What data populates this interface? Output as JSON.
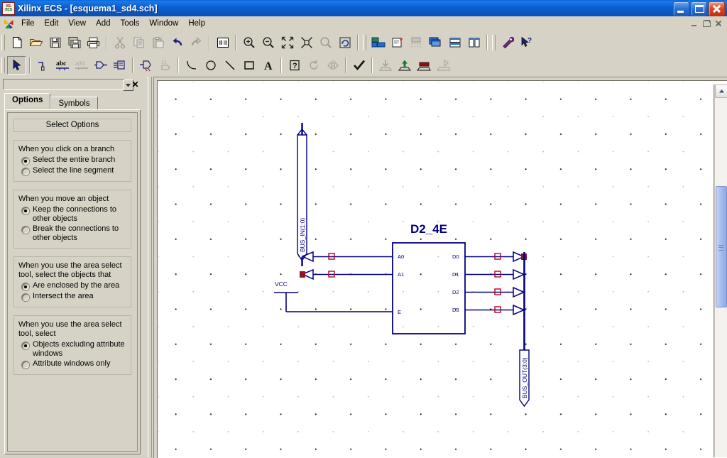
{
  "window": {
    "app_name": "Xilinx ECS",
    "document": "[esquema1_sd4.sch]",
    "title": "Xilinx ECS - [esquema1_sd4.sch]",
    "icon": "xilinx-ecs-icon",
    "controls": {
      "minimize": "minimize-icon",
      "restore": "restore-icon",
      "close": "close-icon"
    },
    "mdi_controls": {
      "minimize": "mdi-minimize-icon",
      "restore": "mdi-restore-icon",
      "close": "mdi-close-icon"
    }
  },
  "menu": {
    "items": [
      {
        "label": "File"
      },
      {
        "label": "Edit"
      },
      {
        "label": "View"
      },
      {
        "label": "Add"
      },
      {
        "label": "Tools"
      },
      {
        "label": "Window"
      },
      {
        "label": "Help"
      }
    ]
  },
  "toolbar_main": {
    "groups": [
      {
        "buttons": [
          {
            "name": "new-icon",
            "enabled": true
          },
          {
            "name": "open-icon",
            "enabled": true
          },
          {
            "name": "save-icon",
            "enabled": true
          },
          {
            "name": "save-all-icon",
            "enabled": true
          },
          {
            "name": "print-icon",
            "enabled": true
          }
        ]
      },
      {
        "buttons": [
          {
            "name": "cut-icon",
            "enabled": false
          },
          {
            "name": "copy-icon",
            "enabled": false
          },
          {
            "name": "paste-icon",
            "enabled": false
          },
          {
            "name": "undo-icon",
            "enabled": true
          },
          {
            "name": "redo-icon",
            "enabled": false
          }
        ]
      },
      {
        "buttons": [
          {
            "name": "find-icon",
            "enabled": true
          }
        ]
      },
      {
        "buttons": [
          {
            "name": "zoom-in-icon",
            "enabled": true
          },
          {
            "name": "zoom-out-icon",
            "enabled": true
          },
          {
            "name": "zoom-fit-icon",
            "enabled": true
          },
          {
            "name": "zoom-selection-icon",
            "enabled": true
          },
          {
            "name": "zoom-area-icon",
            "enabled": false
          },
          {
            "name": "refresh-icon",
            "enabled": true
          }
        ]
      },
      {
        "buttons": [
          {
            "name": "hierarchy-push-icon",
            "enabled": true
          },
          {
            "name": "new-sheet-icon",
            "enabled": true
          },
          {
            "name": "sheet-properties-icon",
            "enabled": false
          },
          {
            "name": "cascade-windows-icon",
            "enabled": true
          },
          {
            "name": "tile-horizontal-icon",
            "enabled": true
          },
          {
            "name": "tile-vertical-icon",
            "enabled": true
          }
        ]
      },
      {
        "buttons": [
          {
            "name": "options-tool-icon",
            "enabled": true
          },
          {
            "name": "context-help-icon",
            "enabled": true
          }
        ]
      }
    ]
  },
  "toolbar_draw": {
    "groups": [
      {
        "buttons": [
          {
            "name": "select-tool-icon",
            "enabled": true,
            "pressed": true
          }
        ]
      },
      {
        "buttons": [
          {
            "name": "add-wire-icon",
            "enabled": true
          },
          {
            "name": "add-net-name-icon",
            "enabled": true
          },
          {
            "name": "add-bus-name-icon",
            "enabled": false
          },
          {
            "name": "add-io-marker-icon",
            "enabled": true
          },
          {
            "name": "add-symbol-icon",
            "enabled": true
          }
        ]
      },
      {
        "buttons": [
          {
            "name": "edit-attributes-icon",
            "enabled": true
          },
          {
            "name": "add-instance-name-icon",
            "enabled": false
          }
        ]
      },
      {
        "buttons": [
          {
            "name": "draw-arc-icon",
            "enabled": true
          },
          {
            "name": "draw-circle-icon",
            "enabled": true
          },
          {
            "name": "draw-line-icon",
            "enabled": true
          },
          {
            "name": "draw-rectangle-icon",
            "enabled": true
          },
          {
            "name": "add-text-icon",
            "enabled": true
          }
        ]
      },
      {
        "buttons": [
          {
            "name": "help-question-icon",
            "enabled": true
          },
          {
            "name": "rotate-icon",
            "enabled": false
          },
          {
            "name": "mirror-icon",
            "enabled": false
          }
        ]
      },
      {
        "buttons": [
          {
            "name": "check-schematic-icon",
            "enabled": true
          }
        ]
      },
      {
        "buttons": [
          {
            "name": "push-into-symbol-icon",
            "enabled": false
          },
          {
            "name": "pop-out-symbol-icon",
            "enabled": true
          },
          {
            "name": "create-symbol-icon",
            "enabled": true
          },
          {
            "name": "export-symbol-icon",
            "enabled": false
          }
        ]
      }
    ]
  },
  "panel": {
    "close_label": "✕",
    "dropdown_icon": "chevron-down-icon",
    "tabs": [
      {
        "label": "Options",
        "active": true
      },
      {
        "label": "Symbols",
        "active": false
      }
    ],
    "group_title": "Select Options",
    "groups": [
      {
        "label": "When you click on a branch",
        "options": [
          {
            "label": "Select the entire branch",
            "selected": true
          },
          {
            "label": "Select the line segment",
            "selected": false
          }
        ]
      },
      {
        "label": "When you move an object",
        "options": [
          {
            "label": "Keep the connections to other objects",
            "selected": true
          },
          {
            "label": "Break the connections to other objects",
            "selected": false
          }
        ]
      },
      {
        "label": "When you use the area select tool, select the objects that",
        "options": [
          {
            "label": "Are enclosed by the area",
            "selected": true
          },
          {
            "label": "Intersect the area",
            "selected": false
          }
        ]
      },
      {
        "label": "When you use the area select tool, select",
        "options": [
          {
            "label": "Objects excluding attribute windows",
            "selected": true
          },
          {
            "label": "Attribute windows only",
            "selected": false
          }
        ]
      }
    ]
  },
  "schematic": {
    "wire_color": "#000080",
    "marker_color": "#b2001e",
    "text_color": "#000080",
    "symbol": {
      "name": "D2_4E",
      "inputs": [
        "A0",
        "A1",
        "E"
      ],
      "outputs": [
        "D0",
        "D1",
        "D2",
        "D3"
      ]
    },
    "labels": {
      "bus_in": "BUS_IN(1:0)",
      "bus_out": "BUS_OUT(3:0)",
      "vcc": "VCC"
    }
  },
  "scrollbar": {
    "up_arrow": "scroll-up-icon",
    "thumb": "scroll-thumb"
  }
}
